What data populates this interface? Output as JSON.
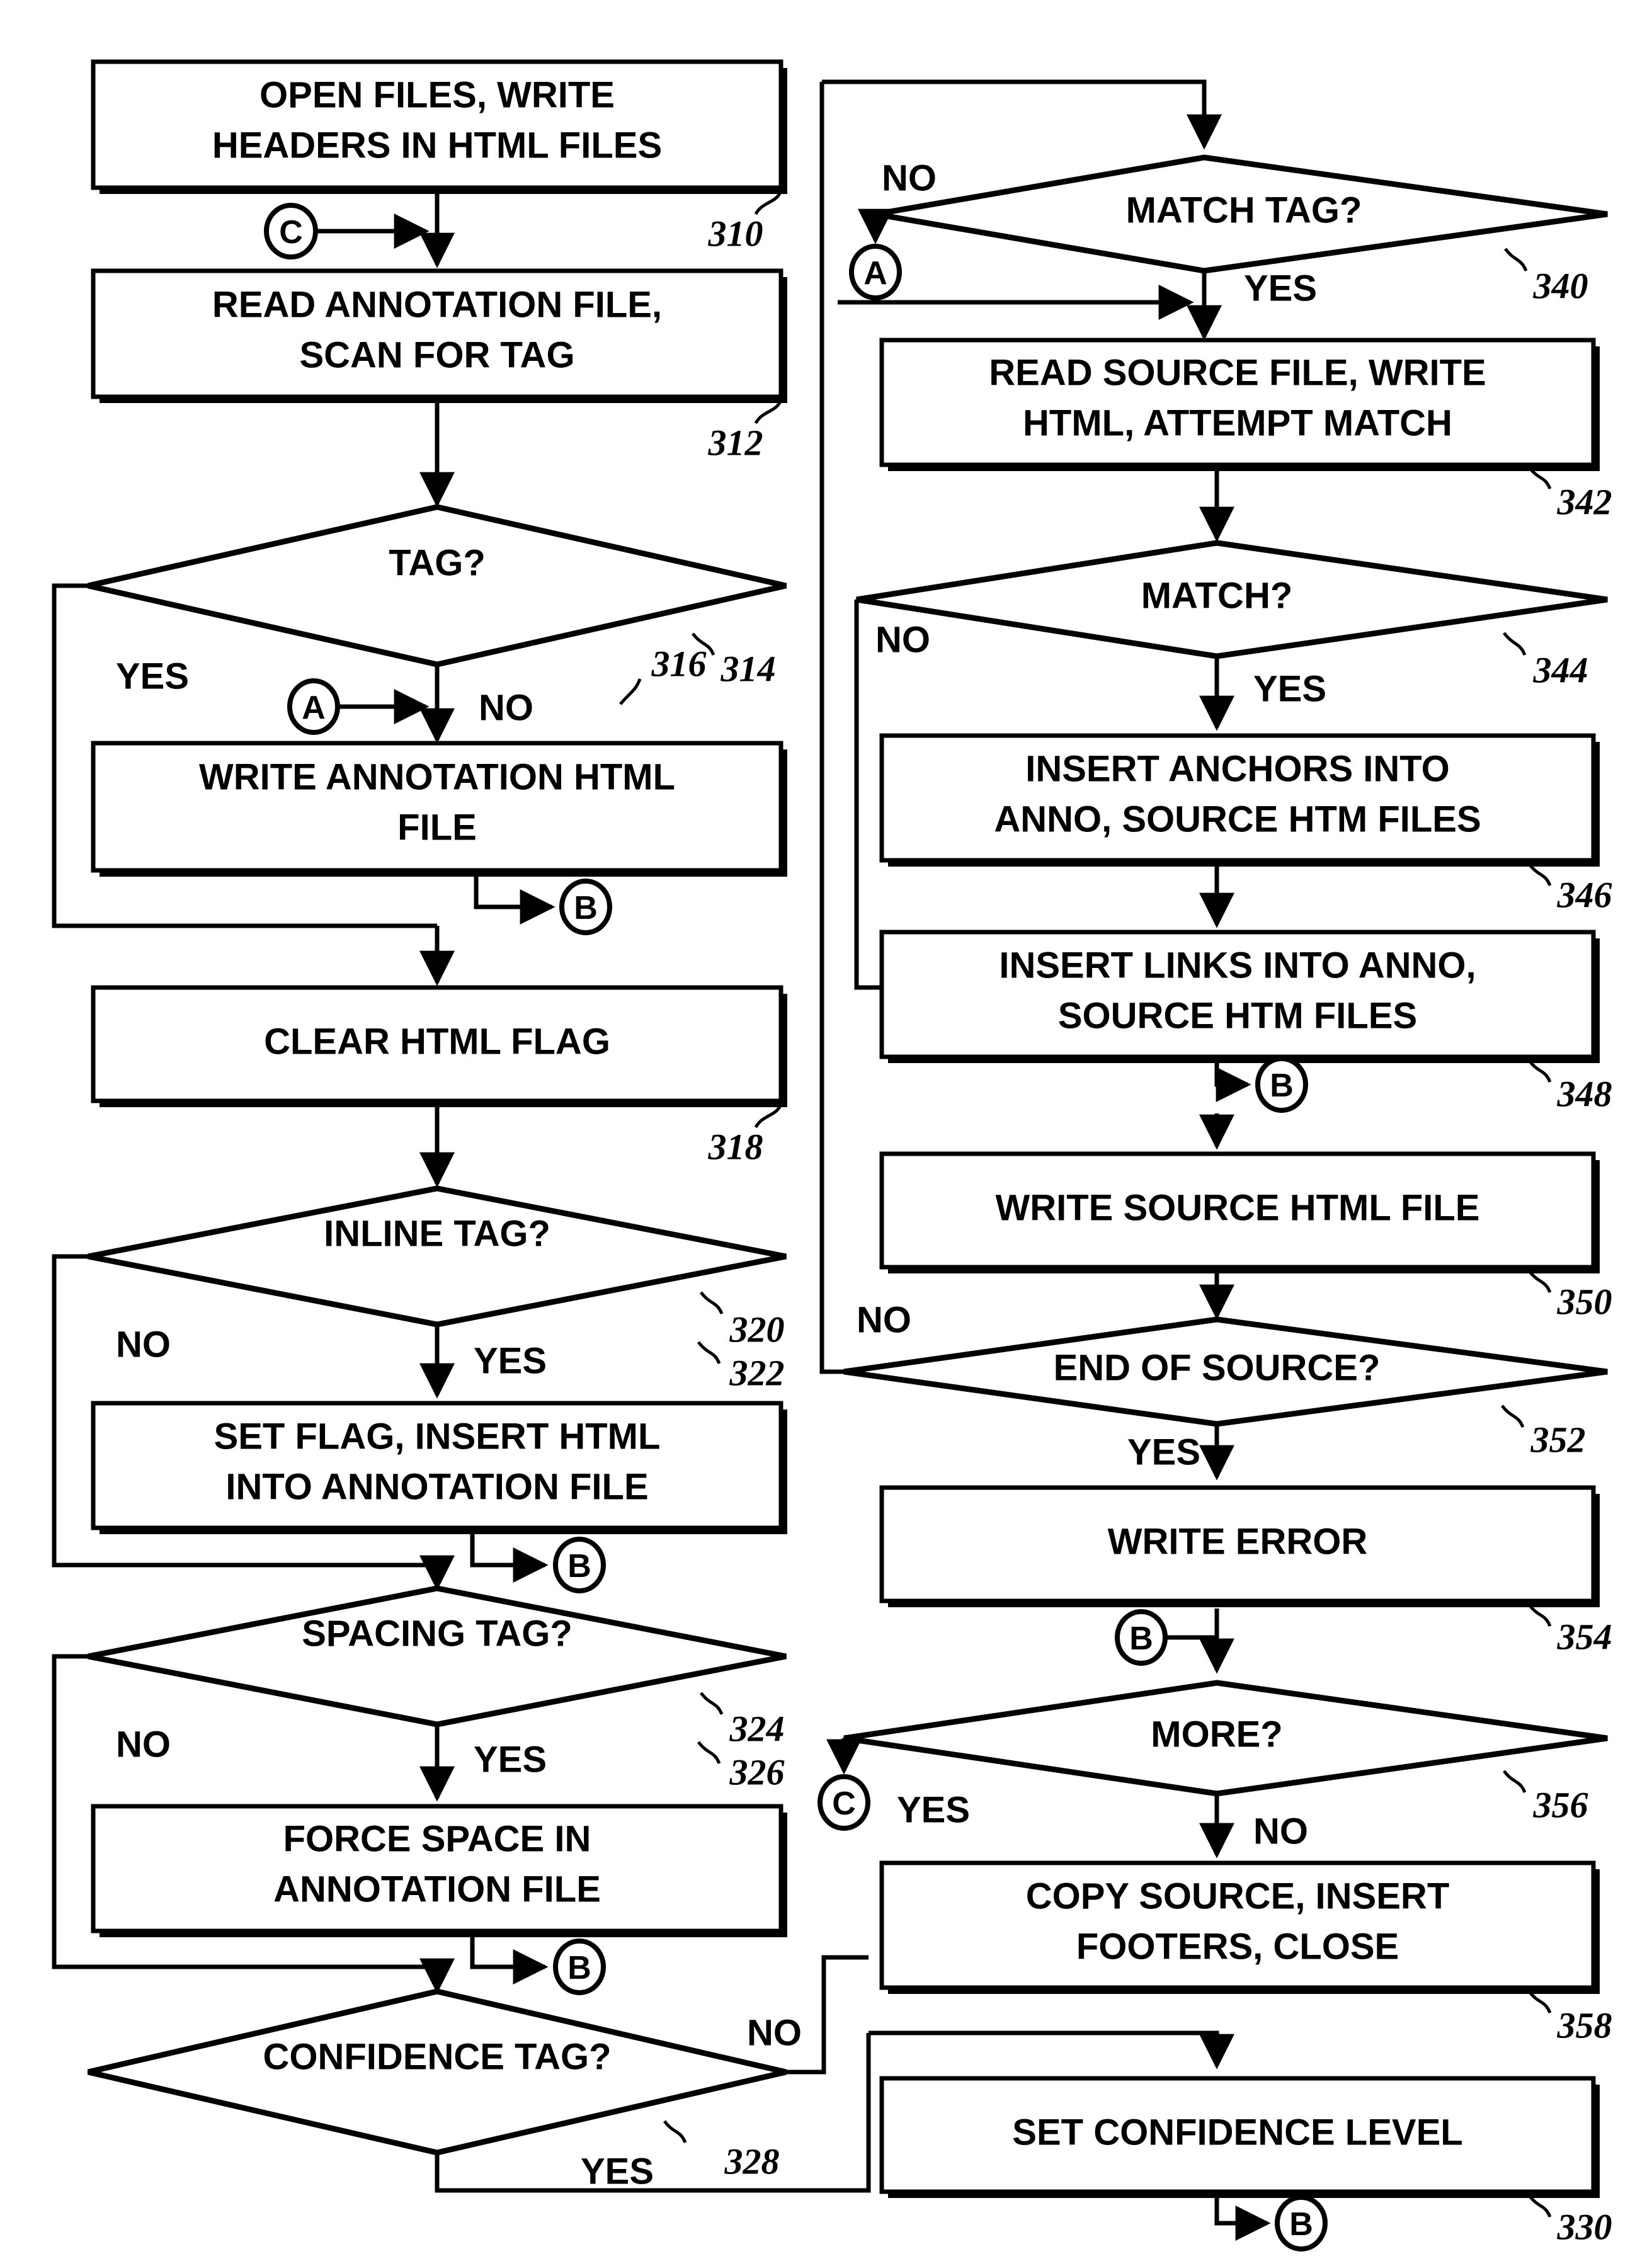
{
  "diagram": {
    "title": "Annotation/Source HTML Generation Flowchart",
    "type": "flowchart"
  },
  "nodes": {
    "n310": {
      "text": "OPEN FILES, WRITE HEADERS IN HTML FILES",
      "line1": "OPEN FILES, WRITE",
      "line2": "HEADERS IN HTML FILES",
      "ref": "310",
      "shape": "process"
    },
    "n312": {
      "text": "READ ANNOTATION FILE, SCAN FOR TAG",
      "line1": "READ ANNOTATION FILE,",
      "line2": "SCAN FOR TAG",
      "ref": "312",
      "shape": "process"
    },
    "n314": {
      "text": "TAG?",
      "ref": "314",
      "shape": "decision"
    },
    "n316": {
      "text": "WRITE ANNOTATION HTML FILE",
      "line1": "WRITE ANNOTATION HTML",
      "line2": "FILE",
      "ref": "316",
      "shape": "process"
    },
    "n318": {
      "text": "CLEAR HTML FLAG",
      "line1": "CLEAR HTML FLAG",
      "line2": "",
      "ref": "318",
      "shape": "process"
    },
    "n320": {
      "text": "INLINE TAG?",
      "ref": "320",
      "shape": "decision"
    },
    "n322": {
      "text": "SET FLAG, INSERT HTML INTO ANNOTATION FILE",
      "line1": "SET FLAG, INSERT HTML",
      "line2": "INTO ANNOTATION FILE",
      "ref": "322",
      "shape": "process"
    },
    "n324": {
      "text": "SPACING TAG?",
      "ref": "324",
      "shape": "decision"
    },
    "n326": {
      "text": "FORCE SPACE IN ANNOTATION FILE",
      "line1": "FORCE SPACE IN",
      "line2": "ANNOTATION FILE",
      "ref": "326",
      "shape": "process"
    },
    "n328": {
      "text": "CONFIDENCE TAG?",
      "ref": "328",
      "shape": "decision"
    },
    "n330": {
      "text": "SET CONFIDENCE LEVEL",
      "line1": "SET CONFIDENCE LEVEL",
      "line2": "",
      "ref": "330",
      "shape": "process"
    },
    "n340": {
      "text": "MATCH TAG?",
      "ref": "340",
      "shape": "decision"
    },
    "n342": {
      "text": "READ SOURCE FILE, WRITE HTML, ATTEMPT MATCH",
      "line1": "READ SOURCE FILE, WRITE",
      "line2": "HTML, ATTEMPT MATCH",
      "ref": "342",
      "shape": "process"
    },
    "n344": {
      "text": "MATCH?",
      "ref": "344",
      "shape": "decision"
    },
    "n346": {
      "text": "INSERT ANCHORS INTO ANNO, SOURCE HTM FILES",
      "line1": "INSERT ANCHORS INTO",
      "line2": "ANNO, SOURCE HTM FILES",
      "ref": "346",
      "shape": "process"
    },
    "n348": {
      "text": "INSERT LINKS INTO ANNO, SOURCE HTM FILES",
      "line1": "INSERT LINKS INTO ANNO,",
      "line2": "SOURCE HTM FILES",
      "ref": "348",
      "shape": "process"
    },
    "n350": {
      "text": "WRITE SOURCE HTML FILE",
      "line1": "WRITE SOURCE HTML FILE",
      "line2": "",
      "ref": "350",
      "shape": "process"
    },
    "n352": {
      "text": "END OF SOURCE?",
      "ref": "352",
      "shape": "decision"
    },
    "n354": {
      "text": "WRITE ERROR",
      "line1": "WRITE ERROR",
      "line2": "",
      "ref": "354",
      "shape": "process"
    },
    "n356": {
      "text": "MORE?",
      "ref": "356",
      "shape": "decision"
    },
    "n358": {
      "text": "COPY SOURCE, INSERT FOOTERS, CLOSE",
      "line1": "COPY SOURCE, INSERT",
      "line2": "FOOTERS, CLOSE",
      "ref": "358",
      "shape": "process"
    }
  },
  "connectors": {
    "c1": {
      "label": "C"
    },
    "a1": {
      "label": "A"
    },
    "b1": {
      "label": "B"
    },
    "b2": {
      "label": "B"
    },
    "b3": {
      "label": "B"
    },
    "a2": {
      "label": "A"
    },
    "b4": {
      "label": "B"
    },
    "b5": {
      "label": "B"
    },
    "c2": {
      "label": "C"
    },
    "b6": {
      "label": "B"
    }
  },
  "edge_labels": {
    "tag_yes": "YES",
    "tag_no": "NO",
    "inline_no": "NO",
    "inline_yes": "YES",
    "spacing_no": "NO",
    "spacing_yes": "YES",
    "confidence_no": "NO",
    "confidence_yes": "YES",
    "matchtag_no": "NO",
    "matchtag_yes": "YES",
    "match_no": "NO",
    "match_yes": "YES",
    "endsource_no": "NO",
    "endsource_yes": "YES",
    "more_yes": "YES",
    "more_no": "NO"
  },
  "colors": {
    "stroke": "#000000",
    "fill": "#ffffff"
  }
}
